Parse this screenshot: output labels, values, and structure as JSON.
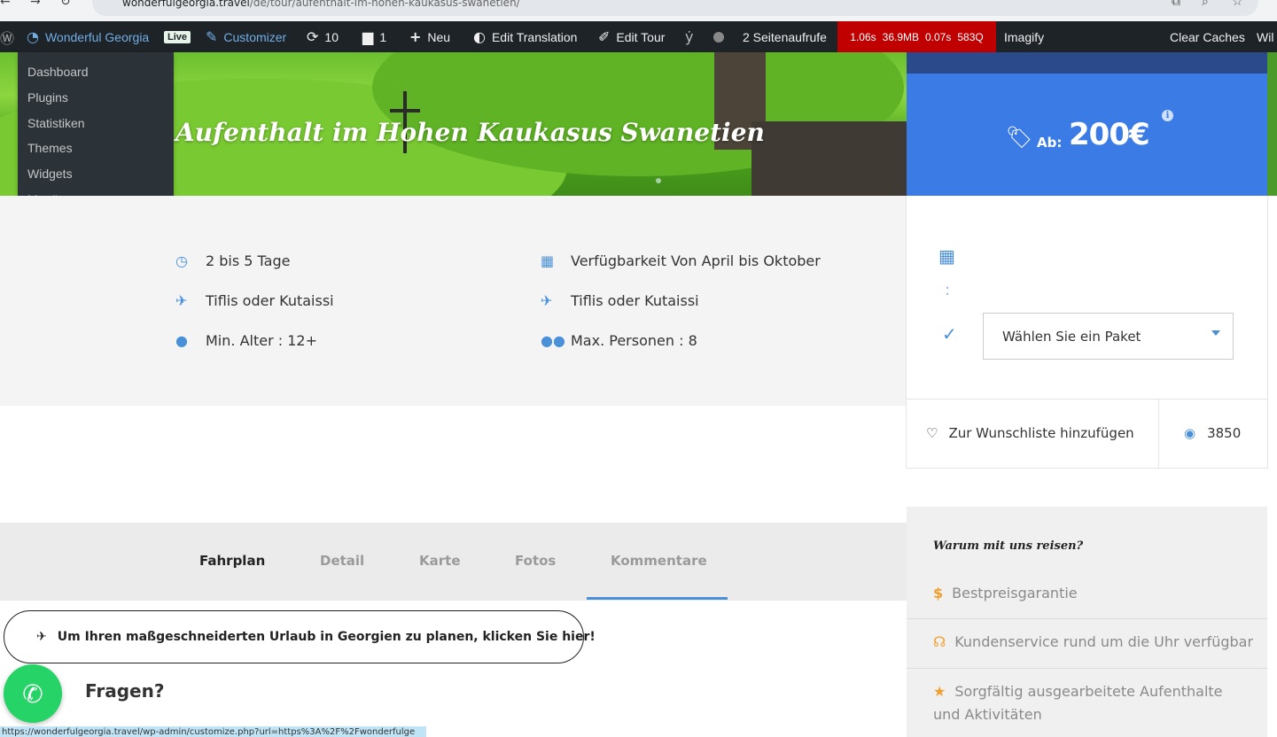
{
  "browser": {
    "url_host": "wonderfulgeorgia.travel",
    "url_path": "/de/tour/aufenthalt-im-hohen-kaukasus-swanetien/"
  },
  "adminbar": {
    "site_name": "Wonderful Georgia",
    "live_badge": "Live",
    "customizer": "Customizer",
    "updates_count": "10",
    "comments_count": "1",
    "new_label": "Neu",
    "edit_translation": "Edit Translation",
    "edit_tour": "Edit Tour",
    "page_views": "2 Seitenaufrufe",
    "qm": {
      "time": "1.06s",
      "memory": "36.9MB",
      "db_time": "0.07s",
      "queries": "583Q"
    },
    "imagify": "Imagify",
    "clear_caches": "Clear Caches",
    "cut_label": "Wil",
    "dropdown": [
      "Dashboard",
      "Plugins",
      "Statistiken",
      "Themes",
      "Widgets",
      "Menüs"
    ]
  },
  "hero": {
    "title": "Aufenthalt im Hohen Kaukasus Swanetien"
  },
  "info": {
    "duration": "2 bis 5 Tage",
    "availability": "Verfügbarkeit Von April bis Oktober",
    "departure": "Tiflis oder Kutaissi",
    "arrival": "Tiflis oder Kutaissi",
    "min_age": "Min. Alter : 12+",
    "max_people": "Max. Personen : 8"
  },
  "booking": {
    "price_prefix": "Ab:",
    "price": "200€",
    "colon": ":",
    "package_placeholder": "Wählen Sie ein Paket",
    "wishlist": "Zur Wunschliste hinzufügen",
    "views": "3850"
  },
  "tabs": [
    "Fahrplan",
    "Detail",
    "Karte",
    "Fotos",
    "Kommentare"
  ],
  "cta": "Um Ihren maßgeschneiderten Urlaub in Georgien zu planen, klicken Sie hier!",
  "fragen": "Fragen?",
  "status_url": "https://wonderfulgeorgia.travel/wp-admin/customize.php?url=https%3A%2F%2Fwonderfulge",
  "why": {
    "title": "Warum mit uns reisen?",
    "items": [
      "Bestpreisgarantie",
      "Kundenservice rund um die Uhr verfügbar",
      "Sorgfältig ausgearbeitete Aufenthalte und Aktivitäten"
    ]
  },
  "colors": {
    "accent": "#4a90d9",
    "price_bg": "#3b7be6",
    "adminbar": "#1d2327",
    "qm_red": "#c00000",
    "whatsapp": "#25d366"
  }
}
